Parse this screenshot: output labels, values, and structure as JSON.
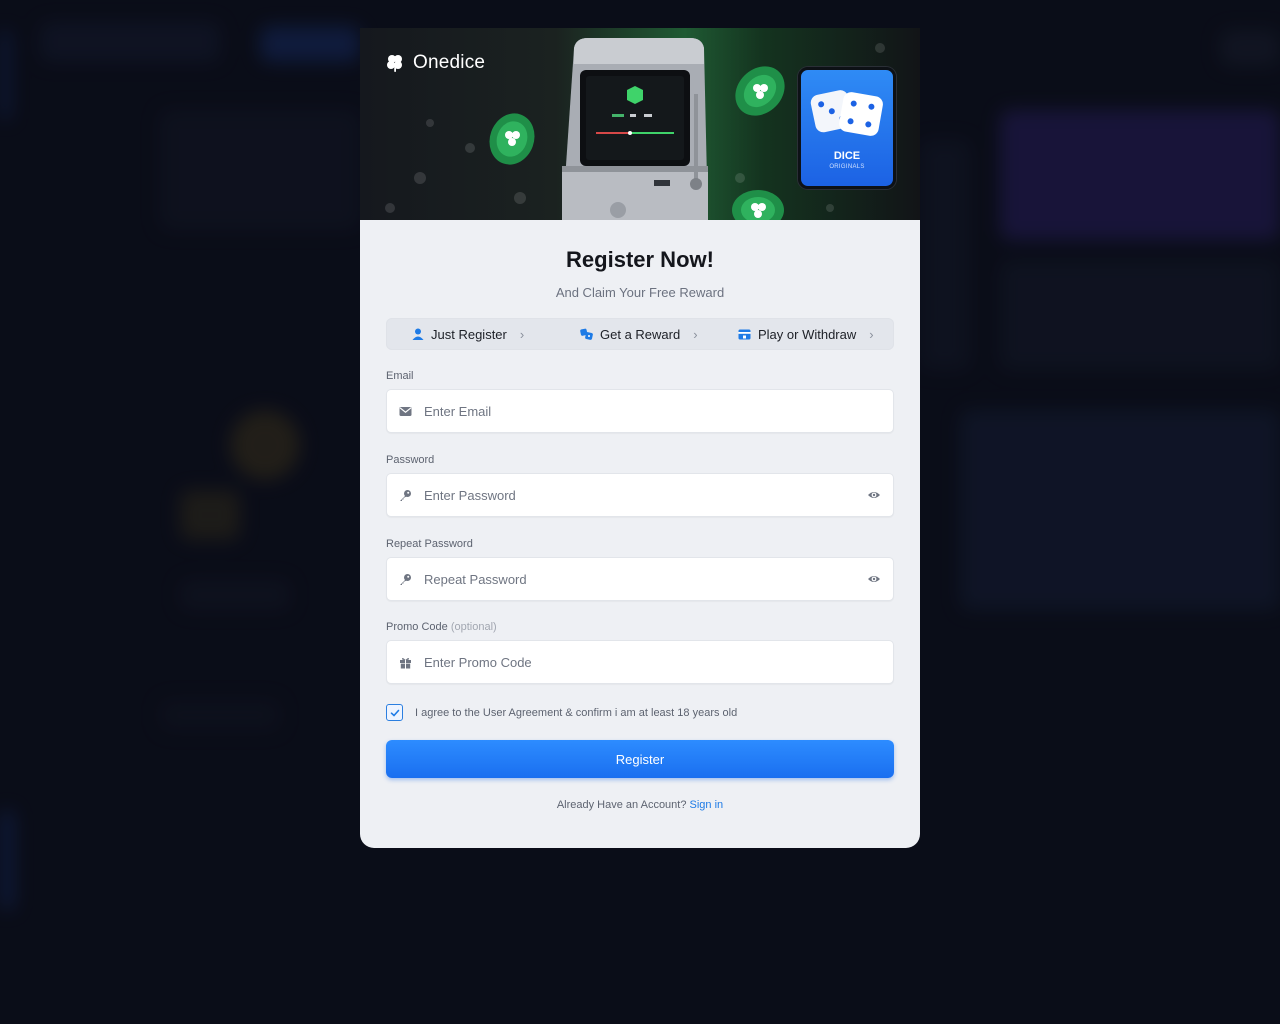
{
  "brand": {
    "name": "Onedice"
  },
  "banner": {
    "card_title": "DICE",
    "card_subtitle": "ORIGINALS"
  },
  "form": {
    "title": "Register Now!",
    "subtitle": "And Claim Your Free Reward",
    "steps": [
      {
        "label": "Just Register",
        "icon": "user-icon"
      },
      {
        "label": "Get a Reward",
        "icon": "dice-icon"
      },
      {
        "label": "Play or Withdraw",
        "icon": "card-icon"
      }
    ],
    "email": {
      "label": "Email",
      "placeholder": "Enter Email",
      "value": ""
    },
    "password": {
      "label": "Password",
      "placeholder": "Enter Password",
      "value": ""
    },
    "repeat_password": {
      "label": "Repeat Password",
      "placeholder": "Repeat Password",
      "value": ""
    },
    "promo": {
      "label": "Promo Code",
      "optional": "(optional)",
      "placeholder": "Enter Promo Code",
      "value": ""
    },
    "agreement": {
      "text": "I agree to the User Agreement & confirm i am at least 18 years old",
      "checked": true
    },
    "submit_label": "Register",
    "account_prompt": "Already Have an Account?",
    "signin_label": "Sign in"
  },
  "colors": {
    "accent": "#1e7be6",
    "banner_green": "#1f5a33",
    "card_blue": "#2f8bf5"
  }
}
